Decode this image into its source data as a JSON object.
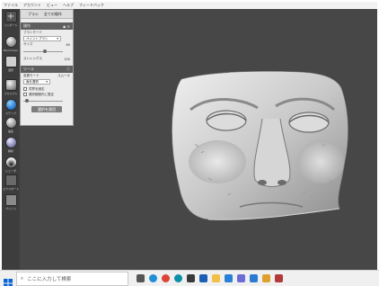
{
  "menubar": {
    "items": [
      "ファイル",
      "アカウント",
      "ビュー",
      "ヘルプ",
      "フィードバック"
    ]
  },
  "toolbar": {
    "items": [
      {
        "label": "インポート",
        "icon": "plus-icon"
      },
      {
        "label": "Meshmixer",
        "icon": "sphere-icon"
      },
      {
        "label": "選択",
        "icon": "brush-icon"
      },
      {
        "label": "スカルプト",
        "icon": "sculpt-brush-icon"
      },
      {
        "label": "ステンプ",
        "icon": "stamp-icon"
      },
      {
        "label": "編集",
        "icon": "edit-icon"
      },
      {
        "label": "解析",
        "icon": "analysis-icon"
      },
      {
        "label": "シェーダ",
        "icon": "shader-icon"
      },
      {
        "label": "エクスポート",
        "icon": "export-icon"
      },
      {
        "label": "プリント",
        "icon": "print-icon"
      }
    ]
  },
  "panel": {
    "top_tabs": [
      "ブラシ",
      "全ての操作"
    ],
    "section1_title": "操作",
    "brush_label": "ブラシモード",
    "brush_value": "ペイントブラシ",
    "size_label": "サイズ",
    "size_value": "60",
    "strength_label": "ストレングス",
    "strength_value": "100",
    "section2_title": "ツール",
    "mode_label": "変更モード",
    "mode_value": "スムース",
    "mode_select": "面を選択",
    "check1": "境界を固定",
    "check2": "選択範囲内に限定",
    "apply_label": "選択を適用"
  },
  "taskbar": {
    "search_placeholder": "ここに入力して検索",
    "apps": [
      {
        "name": "task-view-icon",
        "color": "#555555"
      },
      {
        "name": "edge-icon",
        "color": "#1f8fd6"
      },
      {
        "name": "chrome-icon",
        "color": "#db4437"
      },
      {
        "name": "edge-new-icon",
        "color": "#0c8fa8"
      },
      {
        "name": "store-icon",
        "color": "#3a3a3a"
      },
      {
        "name": "mail-icon",
        "color": "#1a5fb4"
      },
      {
        "name": "explorer-icon",
        "color": "#f0c04a"
      },
      {
        "name": "media-icon",
        "color": "#2a7fd6"
      },
      {
        "name": "photos-icon",
        "color": "#6c6cd6"
      },
      {
        "name": "vscode-icon",
        "color": "#2b7bd3"
      },
      {
        "name": "paint-icon",
        "color": "#e0a030"
      },
      {
        "name": "meshmixer-icon",
        "color": "#b23a3a"
      }
    ]
  },
  "colors": {
    "viewport_bg": "#474747",
    "mesh_light": "#e8e8e8",
    "mesh_mid": "#bdbdbd",
    "mesh_dark": "#7a7a7a"
  }
}
